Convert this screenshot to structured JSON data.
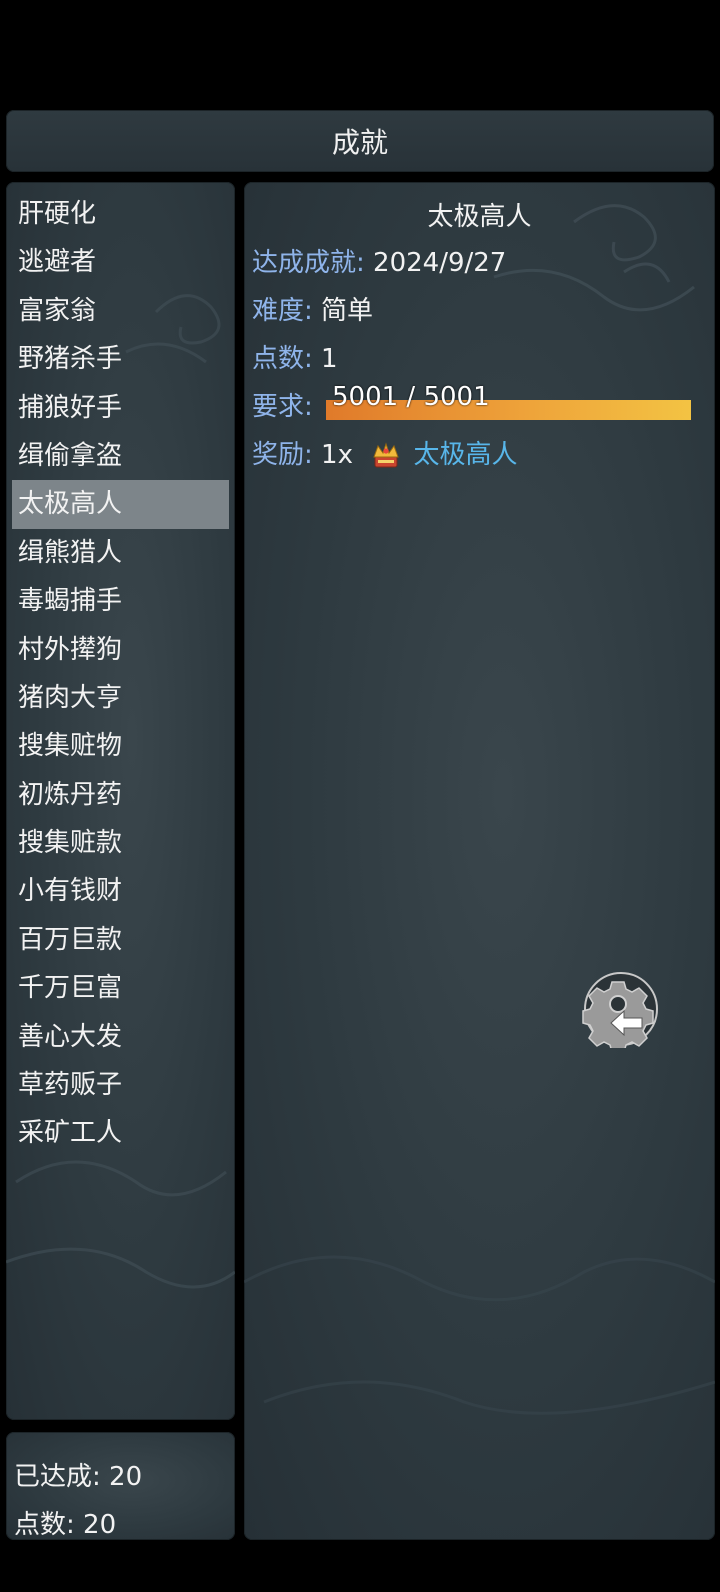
{
  "header": {
    "title": "成就"
  },
  "achievements": [
    "肝硬化",
    "逃避者",
    "富家翁",
    "野猪杀手",
    "捕狼好手",
    "缉偷拿盗",
    "太极高人",
    "缉熊猎人",
    "毒蝎捕手",
    "村外撵狗",
    "猪肉大亨",
    "搜集赃物",
    "初炼丹药",
    "搜集赃款",
    "小有钱财",
    "百万巨款",
    "千万巨富",
    "善心大发",
    "草药贩子",
    "采矿工人"
  ],
  "selected_index": 6,
  "stats": {
    "completed_label": "已达成: 20",
    "points_label": "点数: 20"
  },
  "detail": {
    "title": "太极高人",
    "achieved_key": "达成成就:",
    "achieved_value": "2024/9/27",
    "difficulty_key": "难度:",
    "difficulty_value": "简单",
    "points_key": "点数:",
    "points_value": "1",
    "requirement_key": "要求:",
    "requirement_text": "5001 / 5001",
    "requirement_progress": 1.0,
    "reward_key": "奖励:",
    "reward_qty": "1x",
    "reward_icon": "crown-icon",
    "reward_name": "太极高人"
  },
  "colors": {
    "key": "#8fb4ea",
    "reward_name": "#58b6ea",
    "progress_start": "#e07a2a",
    "progress_end": "#f3c343",
    "selected_row": "#7d858a"
  }
}
